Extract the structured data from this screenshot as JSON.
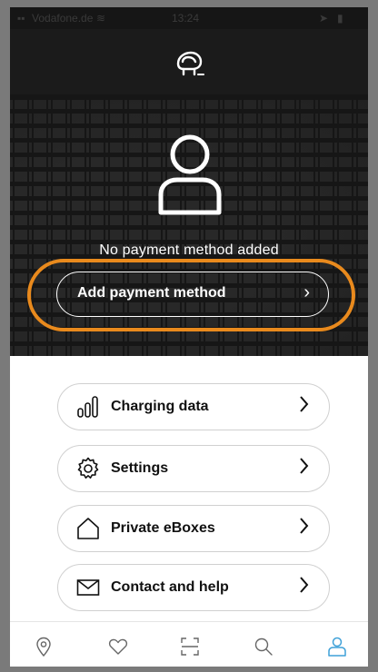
{
  "status_bar": {
    "carrier": "Vodafone.de",
    "time": "13:24"
  },
  "hero": {
    "no_payment_text": "No payment method added",
    "add_payment_label": "Add payment method"
  },
  "menu": {
    "items": [
      {
        "label": "Charging data",
        "icon": "bar-chart-icon"
      },
      {
        "label": "Settings",
        "icon": "gear-icon"
      },
      {
        "label": "Private eBoxes",
        "icon": "house-icon"
      },
      {
        "label": "Contact and help",
        "icon": "envelope-icon"
      }
    ]
  },
  "bottom_nav": {
    "items": [
      "location-pin-icon",
      "heart-icon",
      "scan-icon",
      "search-icon",
      "profile-icon"
    ],
    "active": "profile-icon"
  },
  "colors": {
    "accent": "#3fa1d8",
    "highlight_ring": "#e98a1d",
    "hero_bg": "#161616"
  }
}
